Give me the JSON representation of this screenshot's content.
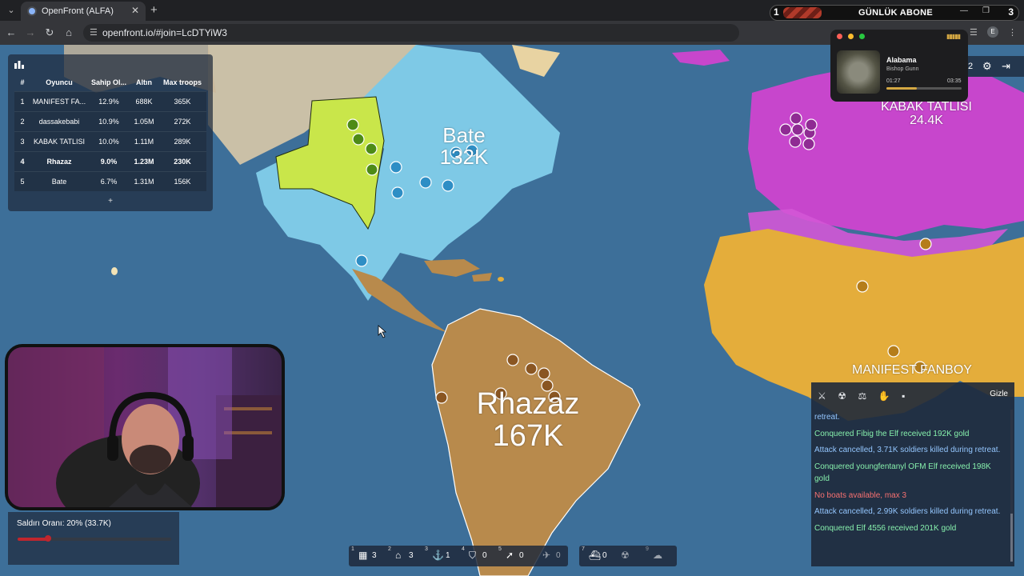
{
  "browser": {
    "tab_title": "OpenFront (ALFA)",
    "url": "openfront.io/#join=LcDTYiW3",
    "profile_initial": "E",
    "promo": {
      "left_number": "1",
      "text": "GÜNLÜK ABONE",
      "right_number": "3"
    }
  },
  "leaderboard": {
    "headers": [
      "#",
      "Oyuncu",
      "Sahip Ol...",
      "Altın",
      "Max troops"
    ],
    "rows": [
      {
        "rank": "1",
        "name": "MANIFEST FA...",
        "owned": "12.9%",
        "gold": "688K",
        "troops": "365K",
        "me": false
      },
      {
        "rank": "2",
        "name": "dassakebabi",
        "owned": "10.9%",
        "gold": "1.05M",
        "troops": "272K",
        "me": false
      },
      {
        "rank": "3",
        "name": "KABAK TATLISI",
        "owned": "10.0%",
        "gold": "1.11M",
        "troops": "289K",
        "me": false
      },
      {
        "rank": "4",
        "name": "Rhazaz",
        "owned": "9.0%",
        "gold": "1.23M",
        "troops": "230K",
        "me": true
      },
      {
        "rank": "5",
        "name": "Bate",
        "owned": "6.7%",
        "gold": "1.31M",
        "troops": "156K",
        "me": false
      }
    ],
    "expand_label": "+"
  },
  "territories": {
    "bate": {
      "name": "Bate",
      "troops": "132K"
    },
    "rhazaz": {
      "name": "Rhazaz",
      "troops": "167K"
    },
    "kabak": {
      "name": "KABAK TATLISI",
      "troops": "24.4K"
    },
    "manifest": {
      "name": "MANIFEST FANBOY"
    }
  },
  "music": {
    "song": "Alabama",
    "artist": "Bishop Gunn",
    "elapsed": "01:27",
    "duration": "03:35",
    "progress": 0.4
  },
  "topright": {
    "count": "2"
  },
  "attack": {
    "label": "Saldırı Oranı: 20% (33.7K)",
    "ratio": 0.2
  },
  "build": [
    {
      "key": "1",
      "icon": "city-icon",
      "glyph": "▦",
      "value": "3"
    },
    {
      "key": "2",
      "icon": "factory-icon",
      "glyph": "⌂",
      "value": "3"
    },
    {
      "key": "3",
      "icon": "port-icon",
      "glyph": "⚓",
      "value": "1"
    },
    {
      "key": "4",
      "icon": "defense-post-icon",
      "glyph": "⛉",
      "value": "0"
    },
    {
      "key": "5",
      "icon": "missile-silo-icon",
      "glyph": "➚",
      "value": "0"
    },
    {
      "key": "",
      "icon": "sam-launcher-icon",
      "glyph": "✈",
      "value": "0"
    },
    {
      "key": "7",
      "icon": "warship-icon",
      "glyph": "⛴",
      "value": "0"
    },
    {
      "key": "",
      "icon": "atom-bomb-icon",
      "glyph": "☢",
      "value": ""
    },
    {
      "key": "9",
      "icon": "hydrogen-bomb-icon",
      "glyph": "☁",
      "value": ""
    }
  ],
  "events": {
    "hide_label": "Gizle",
    "messages": [
      {
        "text": "retreat.",
        "color": "b"
      },
      {
        "text": "Conquered Fibig the Elf received 192K gold",
        "color": "g"
      },
      {
        "text": "Attack cancelled, 3.71K soldiers killed during retreat.",
        "color": "b"
      },
      {
        "text": "Conquered youngfentanyl OFM Elf received 198K gold",
        "color": "g"
      },
      {
        "text": "No boats available, max 3",
        "color": "r"
      },
      {
        "text": "Attack cancelled, 2.99K soldiers killed during retreat.",
        "color": "b"
      },
      {
        "text": "Conquered Elf 4556 received 201K gold",
        "color": "g"
      }
    ]
  },
  "colors": {
    "ocean": "#3d6f99",
    "bate": "#7ec9e6",
    "rhazaz": "#b88a4c",
    "kabak": "#c746cc",
    "manifest": "#e4ad3b",
    "lime_player": "#c9e64a"
  }
}
